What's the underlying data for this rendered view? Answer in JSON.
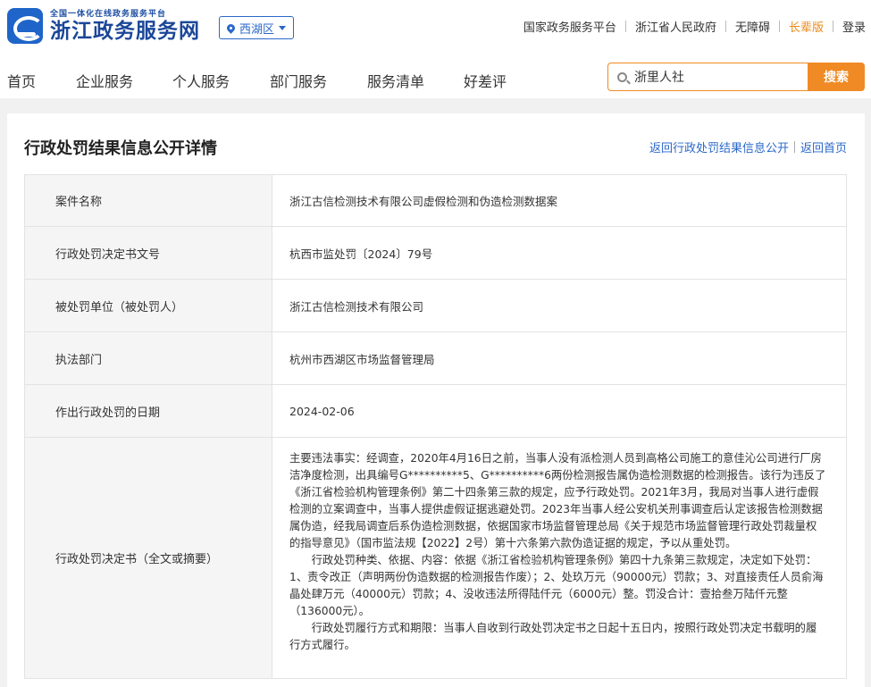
{
  "header": {
    "logo_small": "全国一体化在线政务服务平台",
    "logo_big": "浙江政务服务网",
    "region": "西湖区",
    "links": [
      "国家政务服务平台",
      "浙江省人民政府",
      "无障碍",
      "长辈版",
      "登录"
    ]
  },
  "nav": {
    "items": [
      "首页",
      "企业服务",
      "个人服务",
      "部门服务",
      "服务清单",
      "好差评"
    ],
    "search_value": "浙里人社",
    "search_button": "搜索"
  },
  "panel": {
    "title": "行政处罚结果信息公开详情",
    "link_back_list": "返回行政处罚结果信息公开",
    "link_home": "返回首页"
  },
  "rows": [
    {
      "label": "案件名称",
      "value": "浙江古信检测技术有限公司虚假检测和伪造检测数据案"
    },
    {
      "label": "行政处罚决定书文号",
      "value": "杭西市监处罚〔2024〕79号"
    },
    {
      "label": "被处罚单位（被处罚人）",
      "value": "浙江古信检测技术有限公司"
    },
    {
      "label": "执法部门",
      "value": "杭州市西湖区市场监督管理局"
    },
    {
      "label": "作出行政处罚的日期",
      "value": "2024-02-06"
    }
  ],
  "decision": {
    "label": "行政处罚决定书（全文或摘要）",
    "p1": "主要违法事实：经调查，2020年4月16日之前，当事人没有派检测人员到高格公司施工的意佳沁公司进行厂房洁净度检测，出具编号G**********5、G**********6两份检测报告属伪造检测数据的检测报告。该行为违反了《浙江省检验机构管理条例》第二十四条第三款的规定，应予行政处罚。2021年3月，我局对当事人进行虚假检测的立案调查中，当事人提供虚假证据逃避处罚。2023年当事人经公安机关刑事调查后认定该报告检测数据属伪造，经我局调查后系伪造检测数据，依据国家市场监督管理总局《关于规范市场监督管理行政处罚裁量权的指导意见》（国市监法规【2022】2号）第十六条第六款伪造证据的规定，予以从重处罚。",
    "p2": "行政处罚种类、依据、内容：依据《浙江省检验机构管理条例》第四十九条第三款规定，决定如下处罚：1、责令改正（声明两份伪造数据的检测报告作废）；2、处玖万元（90000元）罚款；3、对直接责任人员俞海晶处肆万元（40000元）罚款；4、没收违法所得陆仟元（6000元）整。罚没合计：壹拾叁万陆仟元整（136000元）。",
    "p3": "行政处罚履行方式和期限：当事人自收到行政处罚决定书之日起十五日内，按照行政处罚决定书载明的履行方式履行。"
  }
}
